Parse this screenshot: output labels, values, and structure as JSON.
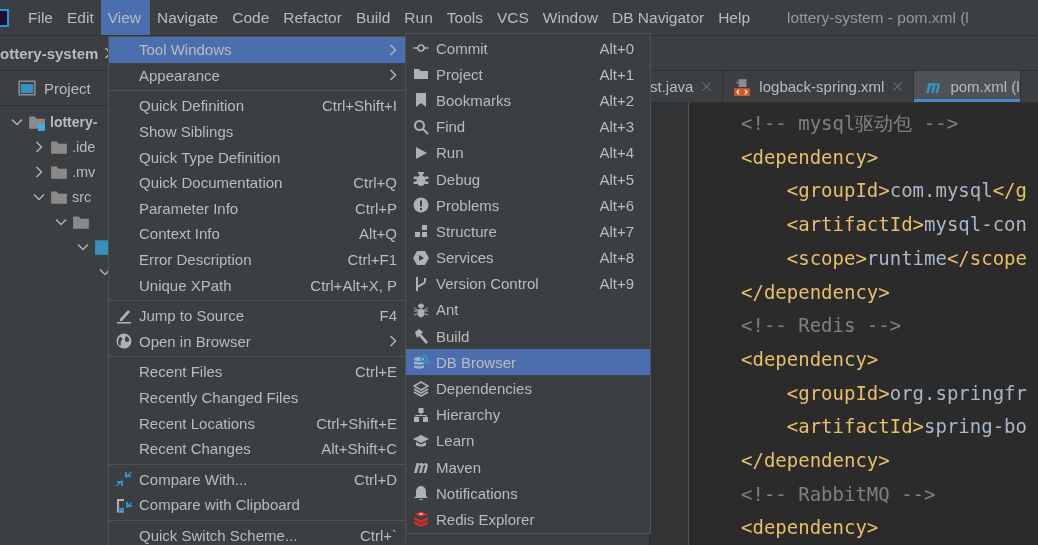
{
  "window": {
    "title": "lottery-system - pom.xml (l"
  },
  "menu_bar": [
    {
      "label": "File",
      "selected": false
    },
    {
      "label": "Edit",
      "selected": false
    },
    {
      "label": "View",
      "selected": true
    },
    {
      "label": "Navigate",
      "selected": false
    },
    {
      "label": "Code",
      "selected": false
    },
    {
      "label": "Refactor",
      "selected": false
    },
    {
      "label": "Build",
      "selected": false
    },
    {
      "label": "Run",
      "selected": false
    },
    {
      "label": "Tools",
      "selected": false
    },
    {
      "label": "VCS",
      "selected": false
    },
    {
      "label": "Window",
      "selected": false
    },
    {
      "label": "DB Navigator",
      "selected": false
    },
    {
      "label": "Help",
      "selected": false
    }
  ],
  "breadcrumb": {
    "label": "ottery-system"
  },
  "project_panel": {
    "title": "Project",
    "tree": [
      {
        "label": "lottery-",
        "expanded": true,
        "children": [
          {
            "label": ".ide",
            "expanded": false
          },
          {
            "label": ".mv",
            "expanded": false
          },
          {
            "label": "src",
            "expanded": true,
            "children": [
              {
                "expanded": true,
                "children": [
                  {
                    "expanded": true,
                    "children": [
                      {
                        "expanded": true
                      }
                    ]
                  }
                ]
              }
            ]
          }
        ]
      }
    ]
  },
  "editor": {
    "tabs": [
      {
        "label": "st.java",
        "selected": false
      },
      {
        "label": "logback-spring.xml",
        "selected": false
      },
      {
        "label": "pom.xml (l",
        "selected": true
      }
    ],
    "lines": [
      {
        "kind": "comment",
        "text": "<!-- mysql驱动包 -->"
      },
      {
        "kind": "code",
        "text": "<dependency>"
      },
      {
        "kind": "code",
        "text": "    <groupId>com.mysql</g"
      },
      {
        "kind": "code",
        "text": "    <artifactId>mysql-con"
      },
      {
        "kind": "code",
        "text": "    <scope>runtime</scope"
      },
      {
        "kind": "code",
        "text": "</dependency>"
      },
      {
        "kind": "comment",
        "text": "<!-- Redis -->"
      },
      {
        "kind": "code",
        "text": "<dependency>"
      },
      {
        "kind": "code",
        "text": "    <groupId>org.springfr"
      },
      {
        "kind": "code",
        "text": "    <artifactId>spring-bo"
      },
      {
        "kind": "code",
        "text": "</dependency>"
      },
      {
        "kind": "comment",
        "text": "<!-- RabbitMQ -->"
      },
      {
        "kind": "code",
        "text": "<dependency>"
      }
    ]
  },
  "view_menu": {
    "items": [
      {
        "kind": "item",
        "label": "Tool Windows",
        "submenu": true,
        "selected": true
      },
      {
        "kind": "item",
        "label": "Appearance",
        "submenu": true,
        "selected": false
      },
      {
        "kind": "separator"
      },
      {
        "kind": "item",
        "label": "Quick Definition",
        "shortcut": "Ctrl+Shift+I",
        "selected": false
      },
      {
        "kind": "item",
        "label": "Show Siblings",
        "selected": false
      },
      {
        "kind": "item",
        "label": "Quick Type Definition",
        "selected": false
      },
      {
        "kind": "item",
        "label": "Quick Documentation",
        "shortcut": "Ctrl+Q",
        "selected": false
      },
      {
        "kind": "item",
        "label": "Parameter Info",
        "shortcut": "Ctrl+P",
        "selected": false
      },
      {
        "kind": "item",
        "label": "Context Info",
        "shortcut": "Alt+Q",
        "selected": false
      },
      {
        "kind": "item",
        "label": "Error Description",
        "shortcut": "Ctrl+F1",
        "selected": false
      },
      {
        "kind": "item",
        "label": "Unique XPath",
        "shortcut": "Ctrl+Alt+X, P",
        "selected": false
      },
      {
        "kind": "separator"
      },
      {
        "kind": "item",
        "label": "Jump to Source",
        "shortcut": "F4",
        "selected": false
      },
      {
        "kind": "item",
        "label": "Open in Browser",
        "submenu": true,
        "selected": false
      },
      {
        "kind": "separator"
      },
      {
        "kind": "item",
        "label": "Recent Files",
        "shortcut": "Ctrl+E",
        "selected": false
      },
      {
        "kind": "item",
        "label": "Recently Changed Files",
        "selected": false
      },
      {
        "kind": "item",
        "label": "Recent Locations",
        "shortcut": "Ctrl+Shift+E",
        "selected": false
      },
      {
        "kind": "item",
        "label": "Recent Changes",
        "shortcut": "Alt+Shift+C",
        "selected": false
      },
      {
        "kind": "separator"
      },
      {
        "kind": "item",
        "label": "Compare With...",
        "shortcut": "Ctrl+D",
        "selected": false
      },
      {
        "kind": "item",
        "label": "Compare with Clipboard",
        "selected": false
      },
      {
        "kind": "separator"
      },
      {
        "kind": "item",
        "label": "Quick Switch Scheme...",
        "shortcut": "Ctrl+`",
        "selected": false
      }
    ]
  },
  "tool_windows_menu": {
    "items": [
      {
        "label": "Commit",
        "shortcut": "Alt+0",
        "selected": false
      },
      {
        "label": "Project",
        "shortcut": "Alt+1",
        "selected": false
      },
      {
        "label": "Bookmarks",
        "shortcut": "Alt+2",
        "selected": false
      },
      {
        "label": "Find",
        "shortcut": "Alt+3",
        "selected": false
      },
      {
        "label": "Run",
        "shortcut": "Alt+4",
        "selected": false
      },
      {
        "label": "Debug",
        "shortcut": "Alt+5",
        "selected": false
      },
      {
        "label": "Problems",
        "shortcut": "Alt+6",
        "selected": false
      },
      {
        "label": "Structure",
        "shortcut": "Alt+7",
        "selected": false
      },
      {
        "label": "Services",
        "shortcut": "Alt+8",
        "selected": false
      },
      {
        "label": "Version Control",
        "shortcut": "Alt+9",
        "selected": false
      },
      {
        "label": "Ant",
        "selected": false
      },
      {
        "label": "Build",
        "selected": false
      },
      {
        "label": "DB Browser",
        "selected": true
      },
      {
        "label": "Dependencies",
        "selected": false
      },
      {
        "label": "Hierarchy",
        "selected": false
      },
      {
        "label": "Learn",
        "selected": false
      },
      {
        "label": "Maven",
        "selected": false
      },
      {
        "label": "Notifications",
        "selected": false
      },
      {
        "label": "Redis Explorer",
        "selected": false
      }
    ]
  }
}
